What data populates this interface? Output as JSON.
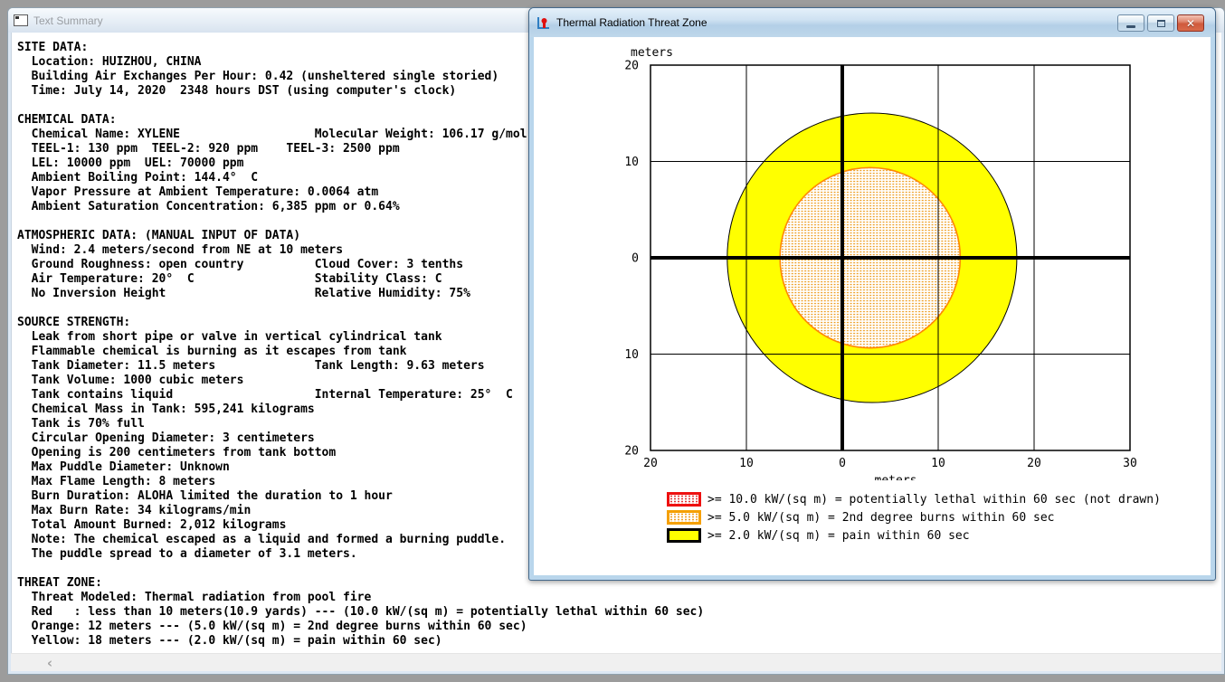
{
  "desktop": {
    "background_color": "#9c9c9c"
  },
  "text_summary_window": {
    "title": "Text Summary",
    "icon": "text-document-icon",
    "scrollbar_left_arrow": "‹",
    "lines": [
      "SITE DATA:",
      "  Location: HUIZHOU, CHINA",
      "  Building Air Exchanges Per Hour: 0.42 (unsheltered single storied)",
      "  Time: July 14, 2020  2348 hours DST (using computer's clock)",
      "",
      "CHEMICAL DATA:",
      "  Chemical Name: XYLENE                   Molecular Weight: 106.17 g/mol",
      "  TEEL-1: 130 ppm  TEEL-2: 920 ppm    TEEL-3: 2500 ppm",
      "  LEL: 10000 ppm  UEL: 70000 ppm",
      "  Ambient Boiling Point: 144.4°  C",
      "  Vapor Pressure at Ambient Temperature: 0.0064 atm",
      "  Ambient Saturation Concentration: 6,385 ppm or 0.64%",
      "",
      "ATMOSPHERIC DATA: (MANUAL INPUT OF DATA)",
      "  Wind: 2.4 meters/second from NE at 10 meters",
      "  Ground Roughness: open country          Cloud Cover: 3 tenths",
      "  Air Temperature: 20°  C                 Stability Class: C",
      "  No Inversion Height                     Relative Humidity: 75%",
      "",
      "SOURCE STRENGTH:",
      "  Leak from short pipe or valve in vertical cylindrical tank",
      "  Flammable chemical is burning as it escapes from tank",
      "  Tank Diameter: 11.5 meters              Tank Length: 9.63 meters",
      "  Tank Volume: 1000 cubic meters",
      "  Tank contains liquid                    Internal Temperature: 25°  C",
      "  Chemical Mass in Tank: 595,241 kilograms",
      "  Tank is 70% full",
      "  Circular Opening Diameter: 3 centimeters",
      "  Opening is 200 centimeters from tank bottom",
      "  Max Puddle Diameter: Unknown",
      "  Max Flame Length: 8 meters",
      "  Burn Duration: ALOHA limited the duration to 1 hour",
      "  Max Burn Rate: 34 kilograms/min",
      "  Total Amount Burned: 2,012 kilograms",
      "  Note: The chemical escaped as a liquid and formed a burning puddle.",
      "  The puddle spread to a diameter of 3.1 meters.",
      "",
      "THREAT ZONE:",
      "  Threat Modeled: Thermal radiation from pool fire",
      "  Red   : less than 10 meters(10.9 yards) --- (10.0 kW/(sq m) = potentially lethal within 60 sec)",
      "  Orange: 12 meters --- (5.0 kW/(sq m) = 2nd degree burns within 60 sec)",
      "  Yellow: 18 meters --- (2.0 kW/(sq m) = pain within 60 sec)"
    ]
  },
  "thermal_window": {
    "title": "Thermal Radiation Threat Zone",
    "icon": "threat-zone-chart-icon",
    "buttons": {
      "minimize": "minimize-icon",
      "restore": "restore-icon",
      "close_glyph": "✕"
    }
  },
  "chart_data": {
    "type": "area",
    "title": "Thermal Radiation Threat Zone",
    "xlabel": "meters",
    "ylabel": "meters",
    "xlim": [
      -20,
      30
    ],
    "ylim": [
      -20,
      20
    ],
    "grid_step": 10,
    "grid": true,
    "x_tick_labels": [
      "20",
      "10",
      "0",
      "10",
      "20",
      "30"
    ],
    "y_tick_labels": [
      "20",
      "10",
      "0",
      "10",
      "20"
    ],
    "zones": [
      {
        "name": "yellow-pain-zone",
        "threshold": ">= 2.0 kW/(sq m)",
        "center_x_m": 3.1,
        "center_y_m": 0,
        "radius_m": 15.1,
        "fill": "#ffff00",
        "stroke": "#000000",
        "pattern": "solid"
      },
      {
        "name": "orange-2nd-degree-burn-zone",
        "threshold": ">= 5.0 kW/(sq m)",
        "center_x_m": 2.9,
        "center_y_m": 0,
        "radius_m": 9.4,
        "fill": "#ffffff",
        "dot_color": "#ee9d20",
        "stroke": "#ff8800",
        "pattern": "dots"
      }
    ],
    "legend_position": "bottom",
    "legend": [
      {
        "swatch": "red-dotted",
        "label": ">= 10.0 kW/(sq m) = potentially lethal within 60 sec (not drawn)"
      },
      {
        "swatch": "orange-dotted",
        "label": ">= 5.0 kW/(sq m) = 2nd degree burns within 60 sec"
      },
      {
        "swatch": "yellow-solid",
        "label": ">= 2.0 kW/(sq m) = pain within 60 sec"
      }
    ]
  }
}
